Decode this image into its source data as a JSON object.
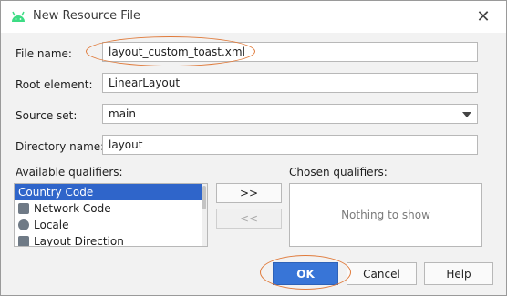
{
  "dialog": {
    "title": "New Resource File"
  },
  "form": {
    "file_name": {
      "label": "File name:",
      "value": "layout_custom_toast.xml"
    },
    "root_element": {
      "label": "Root element:",
      "value": "LinearLayout"
    },
    "source_set": {
      "label": "Source set:",
      "value": "main"
    },
    "directory_name": {
      "label": "Directory name:",
      "value": "layout"
    }
  },
  "qualifiers": {
    "available_label": "Available qualifiers:",
    "chosen_label": "Chosen qualifiers:",
    "items": [
      {
        "label": "Country Code",
        "icon": "country-code-icon"
      },
      {
        "label": "Network Code",
        "icon": "network-code-icon"
      },
      {
        "label": "Locale",
        "icon": "globe-icon"
      },
      {
        "label": "Layout Direction",
        "icon": "layout-direction-icon"
      }
    ],
    "add_label": ">>",
    "remove_label": "<<",
    "empty_text": "Nothing to show"
  },
  "buttons": {
    "ok": "OK",
    "cancel": "Cancel",
    "help": "Help"
  },
  "colors": {
    "accent": "#3875d7",
    "selection": "#2f65ca",
    "annotation": "#e07a3a"
  }
}
